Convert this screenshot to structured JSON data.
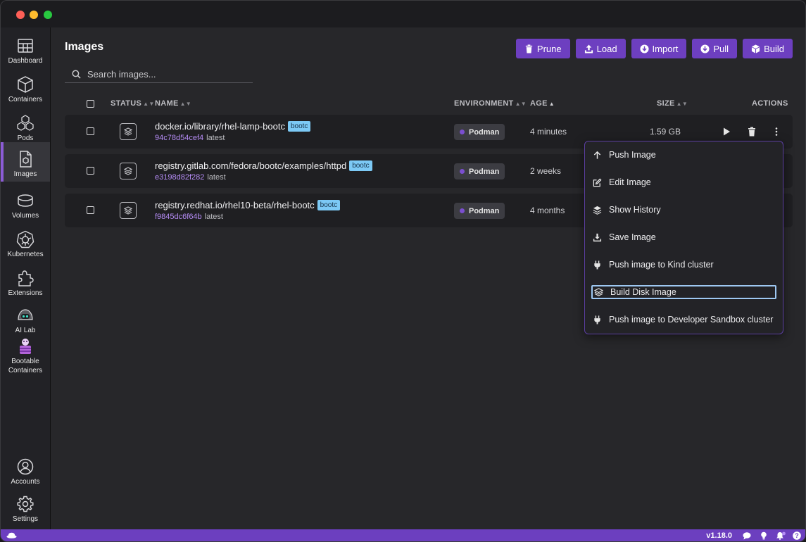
{
  "window": {
    "title": ""
  },
  "sidebar": {
    "items": [
      {
        "label": "Dashboard",
        "icon": "dashboard-icon"
      },
      {
        "label": "Containers",
        "icon": "cube-icon"
      },
      {
        "label": "Pods",
        "icon": "pods-icon"
      },
      {
        "label": "Images",
        "icon": "image-icon",
        "active": true
      },
      {
        "label": "Volumes",
        "icon": "database-icon"
      },
      {
        "label": "Kubernetes",
        "icon": "kubernetes-icon"
      },
      {
        "label": "Extensions",
        "icon": "puzzle-icon"
      },
      {
        "label": "AI Lab",
        "icon": "ai-lab-icon"
      },
      {
        "label": "Bootable Containers",
        "label_line1": "Bootable",
        "label_line2": "Containers",
        "icon": "bootable-containers-icon"
      }
    ],
    "bottom": [
      {
        "label": "Accounts",
        "icon": "user-icon"
      },
      {
        "label": "Settings",
        "icon": "gear-icon"
      }
    ]
  },
  "header": {
    "title": "Images"
  },
  "toolbar": {
    "prune": "Prune",
    "load": "Load",
    "import": "Import",
    "pull": "Pull",
    "build": "Build"
  },
  "search": {
    "placeholder": "Search images..."
  },
  "table": {
    "columns": {
      "status": "STATUS",
      "name": "NAME",
      "environment": "ENVIRONMENT",
      "age": "AGE",
      "size": "SIZE",
      "actions": "ACTIONS"
    },
    "rows": [
      {
        "name": "docker.io/library/rhel-lamp-bootc",
        "badge": "bootc",
        "id": "94c78d54cef4",
        "tag": "latest",
        "environment": "Podman",
        "age": "4 minutes",
        "size": "1.59 GB"
      },
      {
        "name": "registry.gitlab.com/fedora/bootc/examples/httpd",
        "badge": "bootc",
        "id": "e3198d82f282",
        "tag": "latest",
        "environment": "Podman",
        "age": "2 weeks",
        "size": ""
      },
      {
        "name": "registry.redhat.io/rhel10-beta/rhel-bootc",
        "badge": "bootc",
        "id": "f9845dc6f64b",
        "tag": "latest",
        "environment": "Podman",
        "age": "4 months",
        "size": ""
      }
    ]
  },
  "context_menu": {
    "items": [
      {
        "label": "Push Image",
        "icon": "arrow-up-icon"
      },
      {
        "label": "Edit Image",
        "icon": "edit-icon"
      },
      {
        "label": "Show History",
        "icon": "layers-icon"
      },
      {
        "label": "Save Image",
        "icon": "download-icon"
      },
      {
        "label": "Push image to Kind cluster",
        "icon": "plug-icon"
      },
      {
        "label": "Build Disk Image",
        "icon": "disk-image-icon",
        "focused": true
      },
      {
        "label": "Push image to Developer Sandbox cluster",
        "icon": "plug-icon"
      }
    ]
  },
  "statusbar": {
    "version": "v1.18.0"
  },
  "colors": {
    "accent": "#6d3fc0",
    "statusbar": "#6c3fbf",
    "badge": "#7cc9f5",
    "image_id": "#b58cf5"
  }
}
